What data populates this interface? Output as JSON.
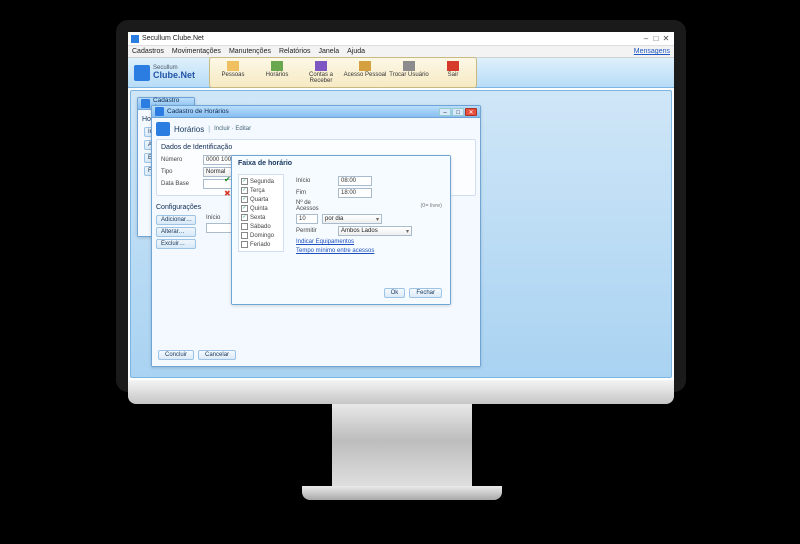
{
  "app": {
    "title": "Secullum Clube.Net",
    "brand_small": "Secullum",
    "brand_big": "Clube.Net"
  },
  "window_controls": {
    "min": "–",
    "max": "□",
    "close": "✕"
  },
  "menu": {
    "items": [
      "Cadastros",
      "Movimentações",
      "Manutenções",
      "Relatórios",
      "Janela",
      "Ajuda"
    ],
    "right_link": "Mensagens"
  },
  "ribbon": {
    "pessoas": "Pessoas",
    "horarios": "Horários",
    "contas": "Contas a Receber",
    "acesso": "Acesso Pessoal",
    "trocar": "Trocar Usuário",
    "sair": "Sair"
  },
  "back_window": {
    "title": "Cadastro d…",
    "header": "Horá",
    "btn_incluir": "Incluir",
    "btn_alterar": "Alterar",
    "btn_excluir": "Excluir",
    "btn_fechar": "Fechar"
  },
  "main_window": {
    "title": "Cadastro de Horários",
    "header": "Horários",
    "breadcrumb": "Incluir · Editar",
    "section_ident": "Dados de Identificação",
    "lbl_numero": "Número",
    "val_numero": "0000 1000",
    "lbl_tipo": "Tipo",
    "val_tipo": "Normal",
    "lbl_database": "Data Base",
    "section_config": "Configurações",
    "cfg_adicionar": "Adicionar…",
    "cfg_alterar": "Alterar…",
    "cfg_excluir": "Excluir…",
    "lbl_inicio_col": "Início",
    "btn_concluir": "Concluir",
    "btn_cancelar": "Cancelar"
  },
  "faixa": {
    "title": "Faixa de horário",
    "days": [
      "Segunda",
      "Terça",
      "Quarta",
      "Quinta",
      "Sexta",
      "Sábado",
      "Domingo",
      "Feriado"
    ],
    "checked": [
      true,
      true,
      true,
      true,
      true,
      false,
      false,
      false
    ],
    "lbl_inicio": "Início",
    "val_inicio": "08:00",
    "lbl_fim": "Fim",
    "val_fim": "18:00",
    "lbl_acessos": "Nº de Acessos",
    "hint_livre": "(0= livre)",
    "val_acessos": "10",
    "sel_periodo_unit": "por dia",
    "lbl_permitir": "Permitir",
    "sel_permitir": "Ambos Lados",
    "link_equip": "Indicar Equipamentos",
    "link_tempo": "Tempo mínimo entre acessos",
    "btn_ok": "Ok",
    "btn_fechar": "Fechar"
  }
}
